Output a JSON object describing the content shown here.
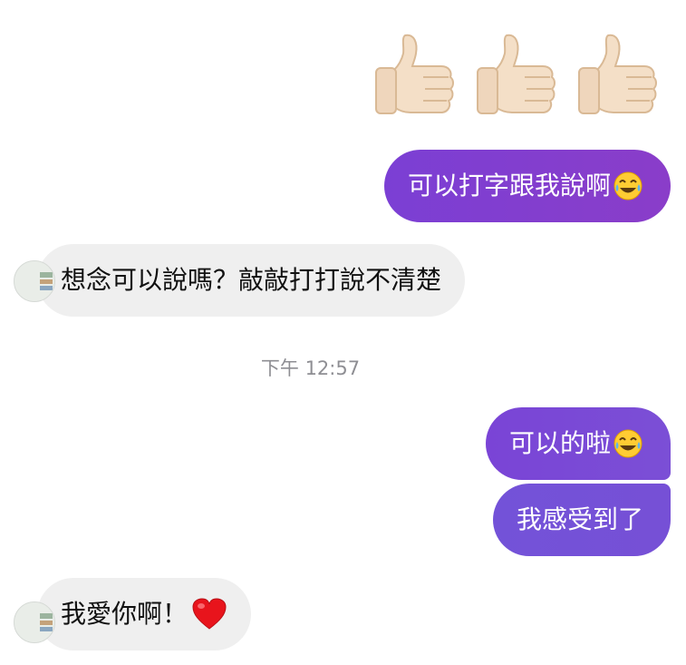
{
  "thread": {
    "reaction_icon": "thumbs-up-icon",
    "reaction_count": 3,
    "messages": [
      {
        "side": "outgoing",
        "text": "可以打字跟我說啊",
        "emoji": "face-with-tears-of-joy-icon"
      },
      {
        "side": "incoming",
        "text": "想念可以說嗎？敲敲打打說不清楚"
      },
      {
        "side": "outgoing",
        "text": "可以的啦",
        "emoji": "face-with-tears-of-joy-icon"
      },
      {
        "side": "outgoing",
        "text": "我感受到了"
      },
      {
        "side": "incoming",
        "text": "我愛你啊！",
        "emoji": "red-heart-icon"
      }
    ],
    "timestamp": "下午 12:57"
  },
  "colors": {
    "outgoing_gradient": [
      "#7b3fd4",
      "#8a3dc9",
      "#7a4ed6"
    ],
    "incoming_bubble": "#efefef",
    "timestamp_text": "#8e8e93"
  }
}
